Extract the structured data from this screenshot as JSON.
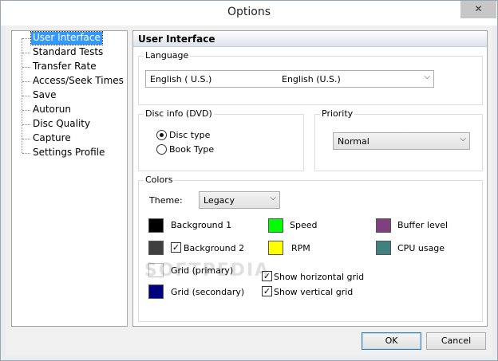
{
  "window": {
    "title": "Options",
    "close_glyph": "✕"
  },
  "tree": {
    "items": [
      {
        "label": "User Interface",
        "selected": true
      },
      {
        "label": "Standard Tests"
      },
      {
        "label": "Transfer Rate"
      },
      {
        "label": "Access/Seek Times"
      },
      {
        "label": "Save"
      },
      {
        "label": "Autorun"
      },
      {
        "label": "Disc Quality"
      },
      {
        "label": "Capture"
      },
      {
        "label": "Settings Profile"
      }
    ]
  },
  "panel": {
    "header": "User Interface",
    "language": {
      "group_label": "Language",
      "value_left": "English ( U.S.)",
      "value_right": "English (U.S.)"
    },
    "disc_info": {
      "group_label": "Disc info (DVD)",
      "options": [
        {
          "label": "Disc type",
          "checked": true
        },
        {
          "label": "Book Type",
          "checked": false
        }
      ]
    },
    "priority": {
      "group_label": "Priority",
      "value": "Normal"
    },
    "colors": {
      "group_label": "Colors",
      "theme_label": "Theme:",
      "theme_value": "Legacy",
      "items": {
        "background1": {
          "label": "Background 1",
          "color": "#000000"
        },
        "background2": {
          "label": "Background 2",
          "color": "#404040",
          "checked": true
        },
        "grid_primary": {
          "label": "Grid (primary)",
          "color": "#ffffff"
        },
        "grid_secondary": {
          "label": "Grid (secondary)",
          "color": "#000080"
        },
        "speed": {
          "label": "Speed",
          "color": "#00ff00"
        },
        "rpm": {
          "label": "RPM",
          "color": "#ffff00"
        },
        "buffer": {
          "label": "Buffer level",
          "color": "#804080"
        },
        "cpu": {
          "label": "CPU usage",
          "color": "#408080"
        }
      },
      "show_horizontal_grid": {
        "label": "Show horizontal grid",
        "checked": true
      },
      "show_vertical_grid": {
        "label": "Show vertical grid",
        "checked": true
      }
    }
  },
  "buttons": {
    "ok": "OK",
    "cancel": "Cancel"
  },
  "watermark": "SOFTPEDIA"
}
